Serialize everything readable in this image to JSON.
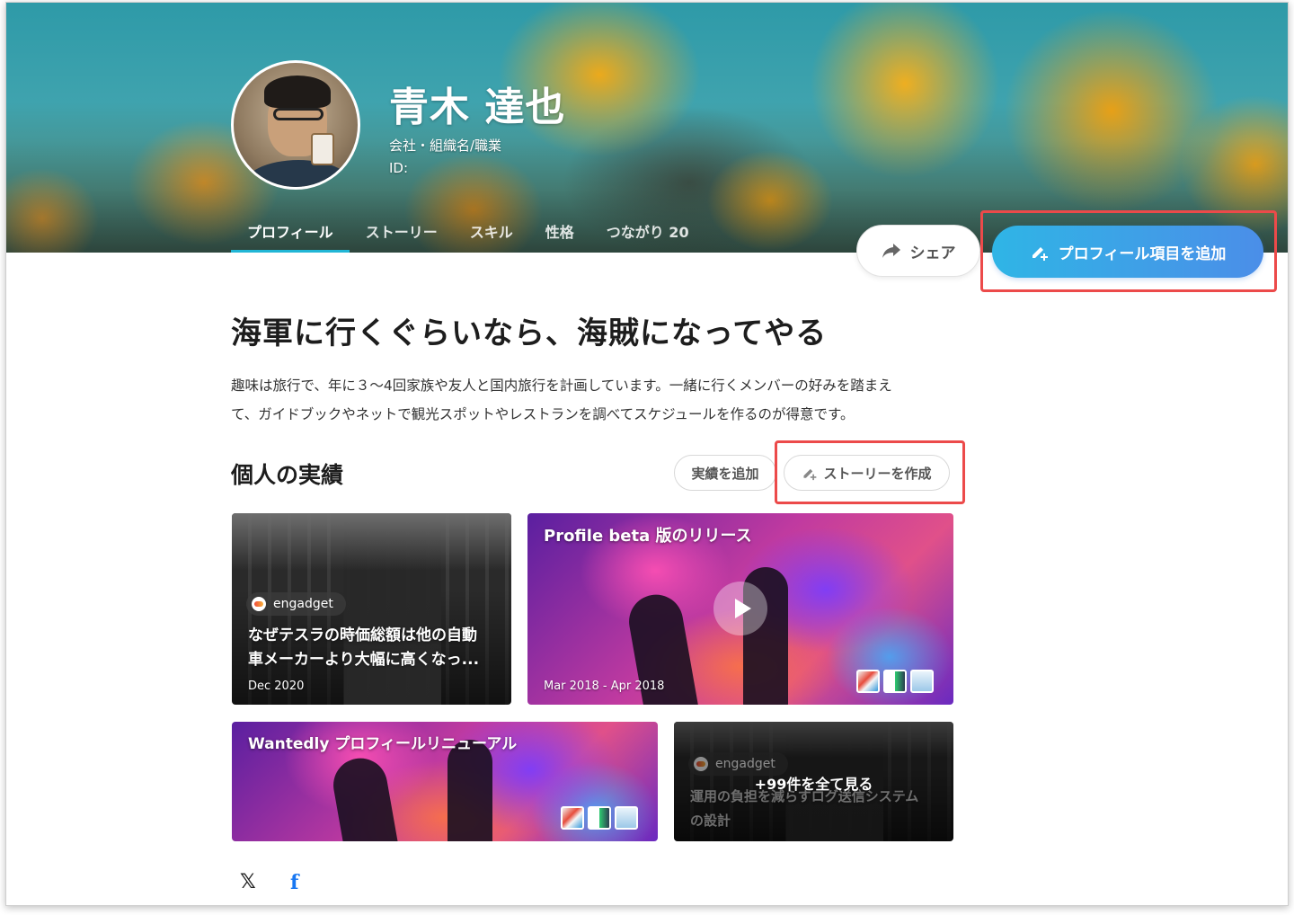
{
  "profile": {
    "name": "青木 達也",
    "subtitle": "会社・組織名/職業",
    "id_label": "ID:"
  },
  "tabs": [
    {
      "label": "プロフィール",
      "active": true
    },
    {
      "label": "ストーリー",
      "active": false
    },
    {
      "label": "スキル",
      "active": false
    },
    {
      "label": "性格",
      "active": false
    },
    {
      "label": "つながり 20",
      "active": false
    }
  ],
  "actions": {
    "share_label": "シェア",
    "share_icon": "share-arrow-icon",
    "add_label": "プロフィール項目を追加",
    "add_icon": "pencil-plus-icon"
  },
  "headline": "海軍に行くぐらいなら、海賊になってやる",
  "bio": {
    "line1": "趣味は旅行で、年に３〜4回家族や友人と国内旅行を計画しています。一緒に行くメンバーの好みを踏まえ",
    "line2": "て、ガイドブックやネットで観光スポットやレストランを調べてスケジュールを作るのが得意です。"
  },
  "achievements": {
    "title": "個人の実績",
    "add_label": "実績を追加",
    "story_label": "ストーリーを作成",
    "cards": [
      {
        "source": "engadget",
        "title_line1": "なぜテスラの時価総額は他の自動",
        "title_line2": "車メーカーより大幅に高くなっ...",
        "date": "Dec 2020"
      },
      {
        "title": "Profile beta 版のリリース",
        "date": "Mar 2018 - Apr 2018",
        "has_video": true
      },
      {
        "title": "Wantedly プロフィールリニューアル"
      },
      {
        "source": "engadget",
        "title_line1": "運用の負担を減らすログ送信システム",
        "title_line2": "の設計",
        "more_label": "+99件を全て見る"
      }
    ]
  },
  "social": {
    "x": "𝕏",
    "facebook": "f"
  },
  "colors": {
    "accent": "#21b6d6",
    "primary_gradient_start": "#2fb5e6",
    "primary_gradient_end": "#4b8ee8",
    "highlight": "#ec4a4a",
    "facebook": "#1877f2"
  }
}
